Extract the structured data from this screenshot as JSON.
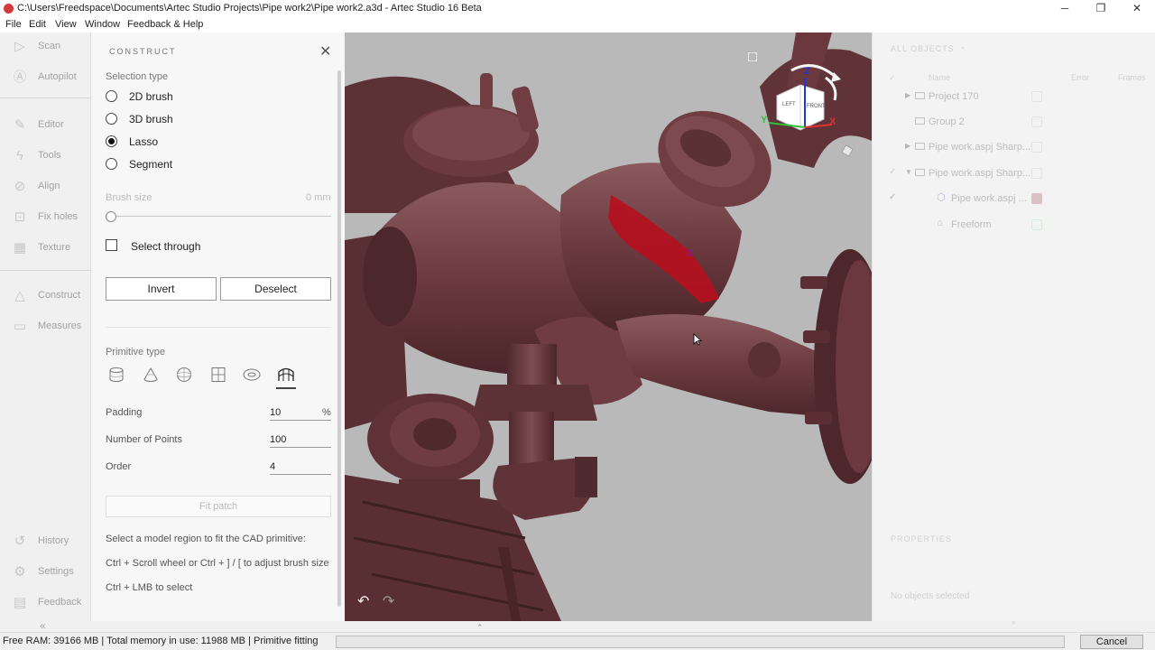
{
  "window": {
    "title": "C:\\Users\\Freedspace\\Documents\\Artec Studio Projects\\Pipe work2\\Pipe work2.a3d - Artec Studio 16 Beta",
    "min_glyph": "─",
    "max_glyph": "❐",
    "close_glyph": "✕"
  },
  "menu": [
    "File",
    "Edit",
    "View",
    "Window",
    "Feedback & Help"
  ],
  "nav": {
    "items": [
      {
        "label": "Scan",
        "icon": "play-icon"
      },
      {
        "label": "Autopilot",
        "icon": "autopilot-icon"
      },
      {
        "label": "Editor",
        "icon": "pencil-icon"
      },
      {
        "label": "Tools",
        "icon": "bolt-icon"
      },
      {
        "label": "Align",
        "icon": "align-icon"
      },
      {
        "label": "Fix holes",
        "icon": "fix-holes-icon"
      },
      {
        "label": "Texture",
        "icon": "texture-icon"
      },
      {
        "label": "Construct",
        "icon": "cone-icon"
      },
      {
        "label": "Measures",
        "icon": "ruler-icon"
      },
      {
        "label": "History",
        "icon": "history-icon"
      },
      {
        "label": "Settings",
        "icon": "gear-icon"
      },
      {
        "label": "Feedback",
        "icon": "chat-icon"
      }
    ],
    "collapse_glyph": "«"
  },
  "construct": {
    "title": "CONSTRUCT",
    "close_glyph": "✕",
    "selection_type_label": "Selection type",
    "selection_options": [
      "2D brush",
      "3D brush",
      "Lasso",
      "Segment"
    ],
    "selected_option": "Lasso",
    "brush_size_label": "Brush size",
    "brush_size_value": "0 mm",
    "brush_size_fraction": 0,
    "select_through_label": "Select through",
    "select_through_checked": false,
    "invert_label": "Invert",
    "deselect_label": "Deselect",
    "primitive_type_label": "Primitive type",
    "primitive_icons": [
      "cylinder-icon",
      "cone-icon",
      "sphere-icon",
      "plane-icon",
      "torus-icon",
      "freeform-patch-icon"
    ],
    "selected_primitive": "freeform-patch-icon",
    "padding_label": "Padding",
    "padding_value": "10",
    "padding_unit": "%",
    "points_label": "Number of Points",
    "points_value": "100",
    "order_label": "Order",
    "order_value": "4",
    "fit_patch_label": "Fit patch",
    "hint1": "Select a model region to fit the CAD primitive:",
    "hint2": "Ctrl + Scroll wheel or Ctrl + ] / [ to adjust brush size",
    "hint3": "Ctrl + LMB to select"
  },
  "viewport": {
    "cube_left": "LEFT",
    "cube_front": "FRONT",
    "axis_x": "X",
    "axis_y": "Y",
    "axis_z": "Z",
    "undo_glyph": "↶",
    "redo_glyph": "↷",
    "expand_glyph": "⌃",
    "model_color": "#6b3a3f",
    "selection_color": "#b5101e"
  },
  "objects": {
    "header": "ALL OBJECTS",
    "col_name": "Name",
    "col_error": "Error",
    "col_frames": "Frames",
    "rows": [
      {
        "label": "Project 170",
        "level": 1,
        "arrow": "▶"
      },
      {
        "label": "Group 2",
        "level": 1,
        "arrow": ""
      },
      {
        "label": "Pipe work.aspj Sharp...",
        "level": 1,
        "arrow": "▶"
      },
      {
        "label": "Pipe work.aspj Sharp...",
        "level": 1,
        "arrow": "▼"
      },
      {
        "label": "Pipe work.aspj ...",
        "level": 2,
        "arrow": ""
      },
      {
        "label": "Freeform",
        "level": 2,
        "arrow": ""
      }
    ],
    "properties_header": "PROPERTIES",
    "empty_text": "No objects selected"
  },
  "status": {
    "text": "Free RAM: 39166 MB  |  Total memory in use: 11988 MB  |   Primitive fitting",
    "progress": 0,
    "cancel_label": "Cancel"
  }
}
